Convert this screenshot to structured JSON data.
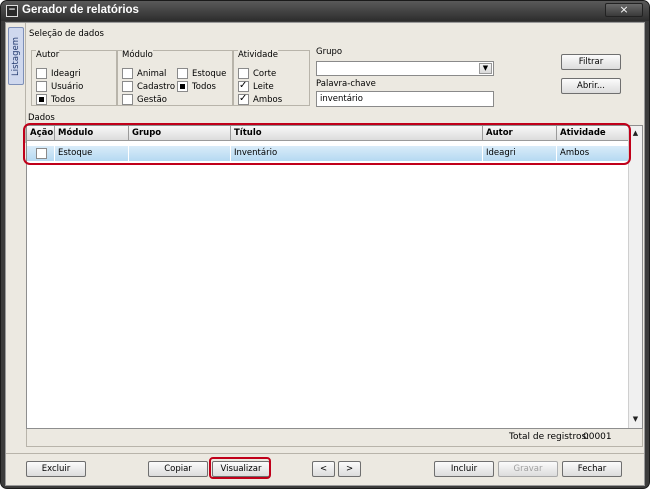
{
  "window": {
    "title": "Gerador de relatórios",
    "close_glyph": "×",
    "system_glyph": "−"
  },
  "side_tab": {
    "label": "Listagem"
  },
  "selection": {
    "title": "Seleção de dados",
    "autor": {
      "title": "Autor",
      "options": [
        "Ideagri",
        "Usuário",
        "Todos"
      ]
    },
    "modulo": {
      "title": "Módulo",
      "options": [
        "Animal",
        "Estoque",
        "Cadastro",
        "Todos",
        "Gestão"
      ]
    },
    "atividade": {
      "title": "Atividade",
      "options": [
        "Corte",
        "Leite",
        "Ambos"
      ]
    },
    "grupo": {
      "label": "Grupo",
      "value": ""
    },
    "palavra_chave": {
      "label": "Palavra-chave",
      "value": "inventário"
    },
    "buttons": {
      "filtrar": "Filtrar",
      "abrir": "Abrir..."
    }
  },
  "data_section": {
    "title": "Dados",
    "columns": [
      "Ação",
      "Módulo",
      "Grupo",
      "Título",
      "Autor",
      "Atividade"
    ],
    "rows": [
      {
        "acao": "",
        "modulo": "Estoque",
        "grupo": "",
        "titulo": "Inventário",
        "autor": "Ideagri",
        "atividade": "Ambos"
      }
    ]
  },
  "status": {
    "total_label": "Total de registros:",
    "total_value": "00001"
  },
  "footer": {
    "excluir": "Excluir",
    "copiar": "Copiar",
    "visualizar": "Visualizar",
    "prev": "<",
    "next": ">",
    "incluir": "Incluir",
    "gravar": "Gravar",
    "fechar": "Fechar"
  },
  "colors": {
    "highlight": "#c0001a",
    "row_selected": "#b5d9f2",
    "window_dark": "#2d2d2d"
  }
}
